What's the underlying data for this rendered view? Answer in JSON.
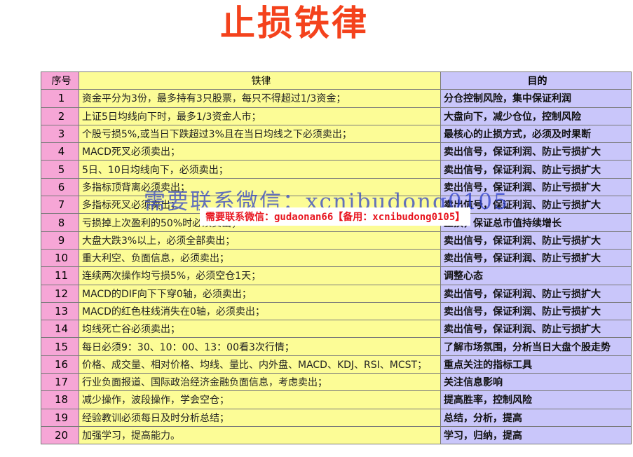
{
  "title": "止损铁律",
  "table": {
    "headers": {
      "num": "序号",
      "rule": "铁律",
      "goal": "目的"
    },
    "rows": [
      {
        "num": "1",
        "rule": "资金平分为3份，最多持有3只股票，每只不得超过1/3资金；",
        "goal": "分仓控制风险，集中保证利润"
      },
      {
        "num": "2",
        "rule": "上证5日均线向下时，最多1/3资金人市；",
        "goal": "大盘向下，减少仓位，控制风险"
      },
      {
        "num": "3",
        "rule": "个股亏损5%,或当日下跌超过3%且在当日均线之下必须卖出；",
        "goal": "最核心的止损方式，必须及时果断"
      },
      {
        "num": "4",
        "rule": "MACD死叉必须卖出；",
        "goal": "卖出信号，保证利润、防止亏损扩大"
      },
      {
        "num": "5",
        "rule": "5日、10日均线向下，必须卖出；",
        "goal": "卖出信号，保证利润、防止亏损扩大"
      },
      {
        "num": "6",
        "rule": "多指标顶背离必须卖出；",
        "goal": "卖出信号，保证利润、防止亏损扩大"
      },
      {
        "num": "7",
        "rule": "多指标死叉必须卖出；",
        "goal": "卖出信号，保证利润、防止亏损扩大"
      },
      {
        "num": "8",
        "rule": "亏损掉上次盈利的50%时必须卖出；",
        "goal": "止损，保证总市值持续增长"
      },
      {
        "num": "9",
        "rule": "大盘大跌3%以上，必须全部卖出；",
        "goal": "卖出信号，保证利润、防止亏损扩大"
      },
      {
        "num": "10",
        "rule": "重大利空、负面信息，必须卖出；",
        "goal": "卖出信号，保证利润、防止亏损扩大"
      },
      {
        "num": "11",
        "rule": "连续两次操作均亏损5%，必须空仓1天；",
        "goal": "调整心态"
      },
      {
        "num": "12",
        "rule": "MACD的DIF向下下穿0轴，必须卖出；",
        "goal": "卖出信号，保证利润、防止亏损扩大"
      },
      {
        "num": "13",
        "rule": "MACD的红色柱线消失在0轴，必须卖出；",
        "goal": "卖出信号，保证利润、防止亏损扩大"
      },
      {
        "num": "14",
        "rule": "均线死亡谷必须卖出；",
        "goal": "卖出信号，保证利润、防止亏损扩大"
      },
      {
        "num": "15",
        "rule": "每日必须9：30、10：00、13：00看3次行情；",
        "goal": "了解市场氛围，分析当日大盘个股走势"
      },
      {
        "num": "16",
        "rule": "价格、成交量、相对价格、均线、量比、内外盘、MACD、KDJ、RSI、MCST；",
        "goal": "重点关注的指标工具"
      },
      {
        "num": "17",
        "rule": "行业负面报道、国际政治经济金融负面信息，考虑卖出；",
        "goal": "关注信息影响"
      },
      {
        "num": "18",
        "rule": "减少操作，波段操作，学会空仓；",
        "goal": "提高胜率，控制风险"
      },
      {
        "num": "19",
        "rule": "经验教训必须每日及时分析总结；",
        "goal": "总结，分析，提高"
      },
      {
        "num": "20",
        "rule": "加强学习，提高能力。",
        "goal": "学习，归纳，提高"
      }
    ]
  },
  "watermarks": {
    "large": "需要联系微信：xcnibudong0105",
    "banner": "需要联系微信：gudaonan66【备用：xcnibudong0105】"
  }
}
